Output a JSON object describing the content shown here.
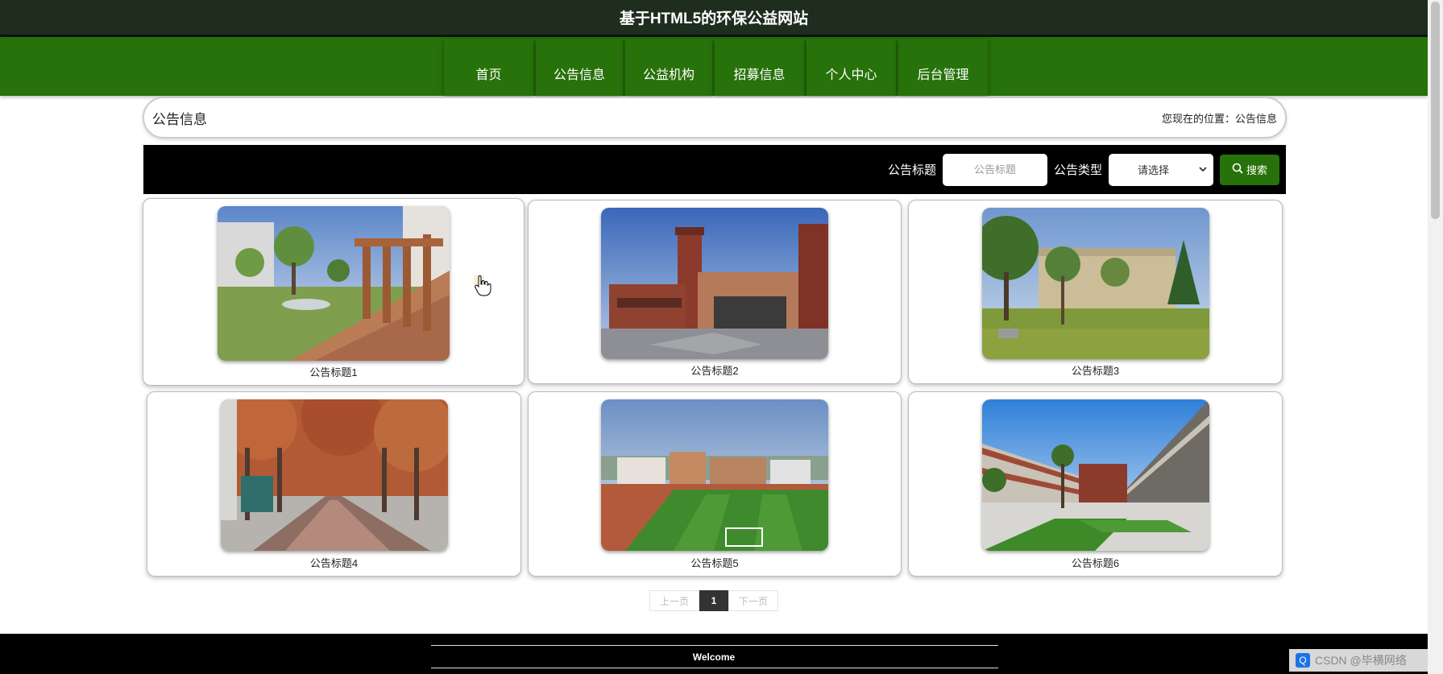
{
  "header": {
    "site_title": "基于HTML5的环保公益网站"
  },
  "nav": {
    "items": [
      {
        "label": "首页"
      },
      {
        "label": "公告信息"
      },
      {
        "label": "公益机构"
      },
      {
        "label": "招募信息"
      },
      {
        "label": "个人中心"
      },
      {
        "label": "后台管理"
      }
    ]
  },
  "breadcrumb": {
    "title": "公告信息",
    "location": "您现在的位置：公告信息"
  },
  "search": {
    "title_label": "公告标题",
    "title_placeholder": "公告标题",
    "type_label": "公告类型",
    "type_selected": "请选择",
    "button_label": "搜索"
  },
  "cards": [
    {
      "caption": "公告标题1"
    },
    {
      "caption": "公告标题2"
    },
    {
      "caption": "公告标题3"
    },
    {
      "caption": "公告标题4"
    },
    {
      "caption": "公告标题5"
    },
    {
      "caption": "公告标题6"
    }
  ],
  "pagination": {
    "prev": "上一页",
    "current": "1",
    "next": "下一页"
  },
  "footer": {
    "welcome": "Welcome"
  },
  "watermark": {
    "text": "CSDN @毕横网络"
  },
  "colors": {
    "nav_green": "#27720a",
    "top_dark": "#1e2d1d",
    "search_bg": "#000000"
  }
}
